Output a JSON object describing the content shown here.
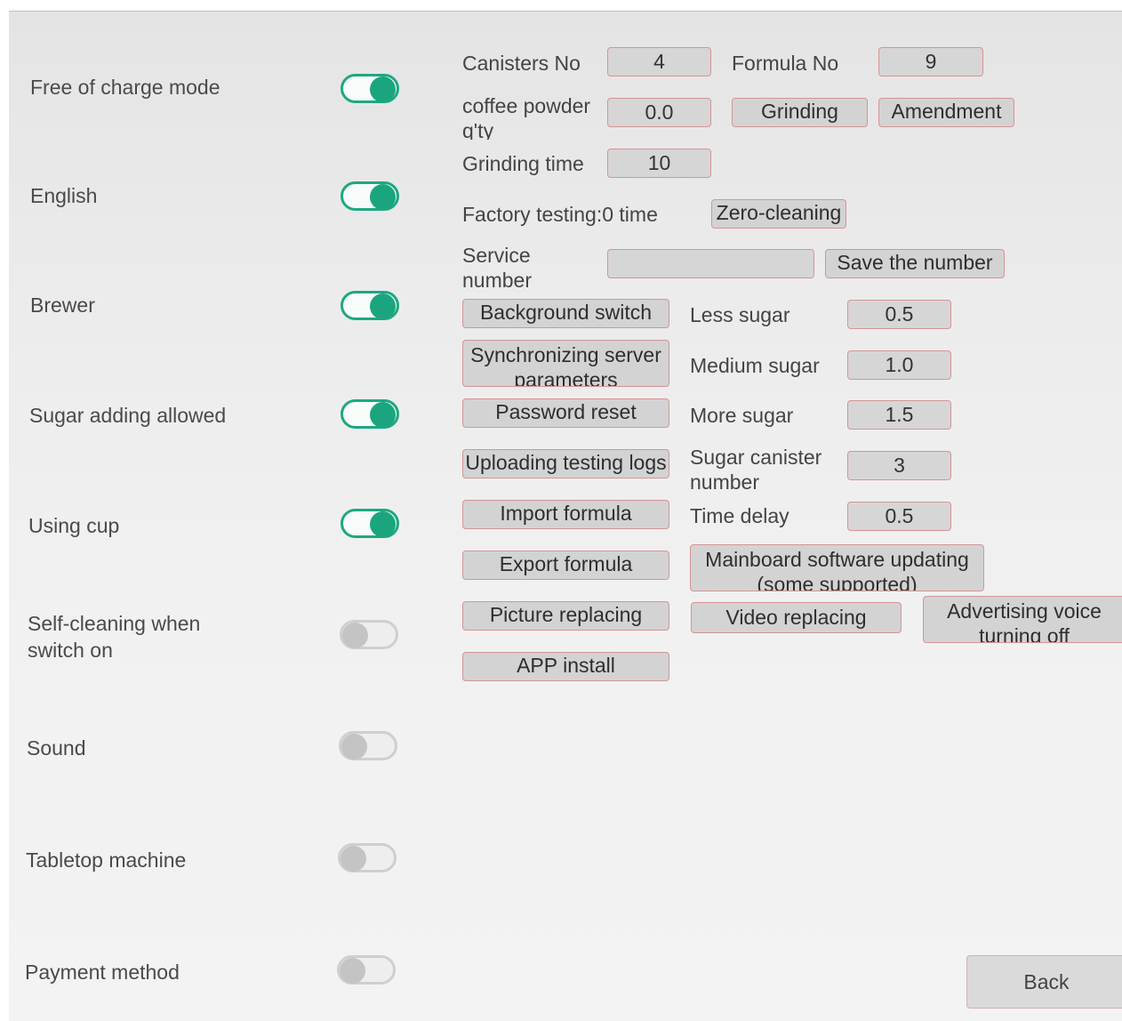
{
  "toggles": [
    {
      "label": "Free of charge mode",
      "on": true
    },
    {
      "label": "English",
      "on": true
    },
    {
      "label": "Brewer",
      "on": true
    },
    {
      "label": "Sugar adding allowed",
      "on": true
    },
    {
      "label": "Using cup",
      "on": true
    },
    {
      "label": "Self-cleaning when switch on",
      "on": false
    },
    {
      "label": "Sound",
      "on": false
    },
    {
      "label": "Tabletop machine",
      "on": false
    },
    {
      "label": "Payment method",
      "on": false
    }
  ],
  "settings": {
    "canisters_label": "Canisters No",
    "canisters_value": "4",
    "formula_label": "Formula No",
    "formula_value": "9",
    "coffee_powder_label": "coffee powder q'ty",
    "coffee_powder_value": "0.0",
    "grinding_button": "Grinding",
    "amendment_button": "Amendment",
    "grinding_time_label": "Grinding time",
    "grinding_time_value": "10",
    "factory_testing_label": "Factory testing:0 time",
    "zero_cleaning_button": "Zero-cleaning",
    "service_number_label": "Service number",
    "service_number_value": "",
    "save_number_button": "Save the number"
  },
  "actions": {
    "background_switch": "Background switch",
    "sync_server": "Synchronizing server parameters",
    "password_reset": "Password reset",
    "upload_logs": "Uploading testing logs",
    "import_formula": "Import formula",
    "export_formula": "Export formula",
    "picture_replacing": "Picture replacing",
    "app_install": "APP install",
    "mainboard_update": "Mainboard software updating (some supported)",
    "video_replacing": "Video replacing",
    "advertising_voice": "Advertising voice turning off"
  },
  "sugar": {
    "less_label": "Less sugar",
    "less_value": "0.5",
    "medium_label": "Medium sugar",
    "medium_value": "1.0",
    "more_label": "More sugar",
    "more_value": "1.5",
    "canister_label": "Sugar canister number",
    "canister_value": "3",
    "delay_label": "Time delay",
    "delay_value": "0.5"
  },
  "back_button": "Back"
}
